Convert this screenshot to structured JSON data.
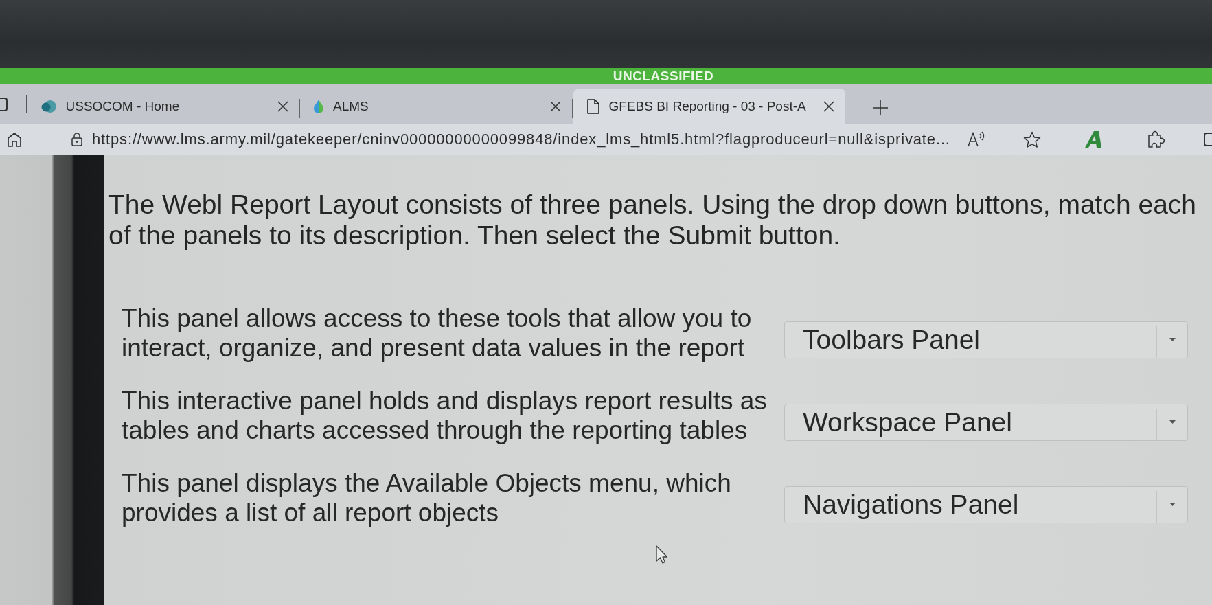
{
  "banner": {
    "text": "UNCLASSIFIED"
  },
  "tabs": [
    {
      "title": "USSOCOM - Home",
      "selected": false
    },
    {
      "title": "ALMS",
      "selected": false
    },
    {
      "title": "GFEBS BI Reporting - 03 - Post-A",
      "selected": true
    }
  ],
  "address_bar": {
    "url": "https://www.lms.army.mil/gatekeeper/cninv00000000000099848/index_lms_html5.html?flagproduceurl=null&isprivate..."
  },
  "instructions": "The Webl Report Layout consists of three panels. Using the drop down buttons, match each of the panels to its description. Then select the Submit button.",
  "matches": [
    {
      "description": "This panel allows access to these tools that allow you to interact, organize, and present data values in the report",
      "answer": "Toolbars Panel"
    },
    {
      "description": "This interactive panel holds and displays report results as tables and charts accessed through the reporting tables",
      "answer": "Workspace Panel"
    },
    {
      "description": "This panel displays the Available Objects menu, which provides a list of all report objects",
      "answer": "Navigations Panel"
    }
  ]
}
